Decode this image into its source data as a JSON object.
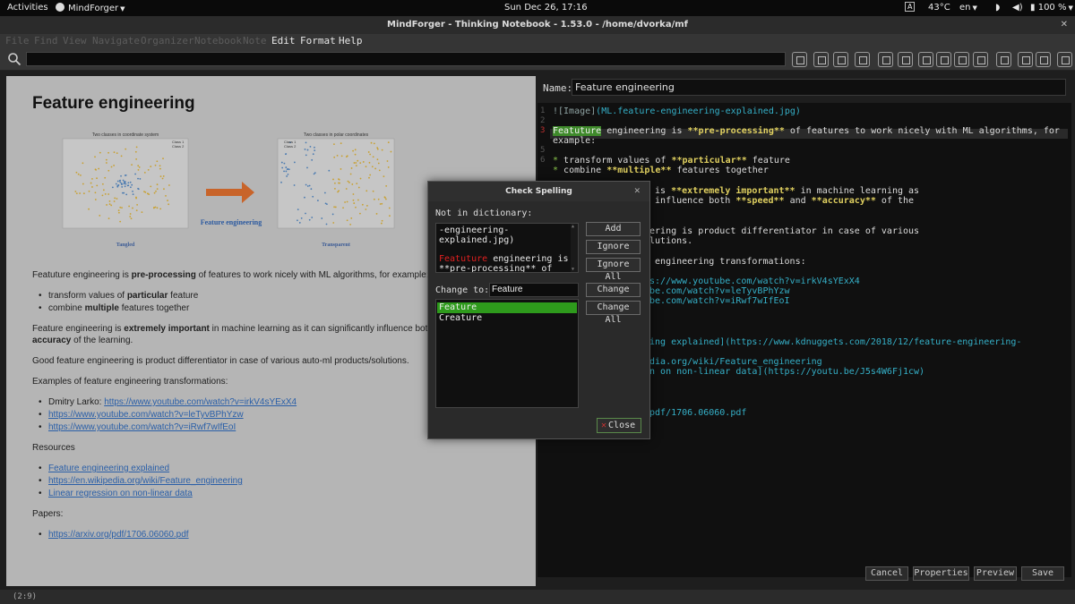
{
  "system_bar": {
    "activities": "Activities",
    "app_menu": "MindForger",
    "clock": "Sun Dec 26, 17:16",
    "keyboard": "A",
    "temperature": "43°C",
    "language": "en",
    "battery": "100 %"
  },
  "window": {
    "title": "MindForger - Thinking Notebook - 1.53.0 - /home/dvorka/mf"
  },
  "menubar": {
    "items": [
      "File",
      "Find",
      "View",
      "Navigate",
      "Organizer",
      "Notebook",
      "Note",
      "Edit",
      "Format",
      "Help"
    ]
  },
  "toolbar": {
    "icons": [
      "new-note-icon",
      "open-folder-icon",
      "notebooks-icon",
      "home-icon",
      "outline-icon",
      "grid-icon",
      "table-icon",
      "chart-icon",
      "tag-icon",
      "clock-icon",
      "lightbulb-icon",
      "filter-icon",
      "tools-icon",
      "adapt-icon"
    ]
  },
  "preview": {
    "title": "Feature engineering",
    "figure": {
      "left_title": "Two classes in coordinate system",
      "right_title": "Two classes in polar coordinates",
      "legend_1": "Class 1",
      "legend_2": "Class 2",
      "left_caption": "Tangled",
      "right_caption": "Transparent",
      "center_caption": "Feature engineering"
    },
    "p1_a": "Featuture engineering is ",
    "p1_b": "pre-processing",
    "p1_c": " of features to work nicely with ML algorithms, for example:",
    "b1_a": "transform values of ",
    "b1_b": "particular",
    "b1_c": " feature",
    "b2_a": "combine ",
    "b2_b": "multiple",
    "b2_c": " features together",
    "p2_a": "Feature engineering is ",
    "p2_b": "extremely important",
    "p2_c": " in machine learning as it can significantly influence both ",
    "p2_d": "accuracy",
    "p2_e": " of the learning.",
    "p3": "Good feature engineering is product differentiator in case of various auto-ml products/solutions.",
    "p4": "Examples of feature engineering transformations:",
    "ex1_label": "Dmitry Larko: ",
    "ex1_link": "https://www.youtube.com/watch?v=irkV4sYExX4",
    "ex2_link": "https://www.youtube.com/watch?v=leTyvBPhYzw",
    "ex3_link": "https://www.youtube.com/watch?v=iRwf7wIfEoI",
    "resources": "Resources",
    "r1": "Feature engineering explained",
    "r2": "https://en.wikipedia.org/wiki/Feature_engineering",
    "r3": "Linear regression on non-linear data",
    "papers": "Papers:",
    "paper1": "https://arxiv.org/pdf/1706.06060.pdf"
  },
  "editor": {
    "name_label": "Name:",
    "name_value": "Feature engineering",
    "lines": {
      "l1_a": "![Image]",
      "l1_b": "(ML.feature-engineering-explained.jpg)",
      "l3_sel": "Featuture",
      "l3_a": " engineering is ",
      "l3_b": "**pre-processing**",
      "l3_c": " of features to work nicely with ML algorithms, for",
      "l4": "example:",
      "l6_a": "* ",
      "l6_b": "transform values of ",
      "l6_c": "**particular**",
      "l6_d": " feature",
      "l7_a": "* ",
      "l7_b": "combine ",
      "l7_c": "**multiple**",
      "l7_d": " features together",
      "l9_a": "g is ",
      "l9_b": "**extremely important**",
      "l9_c": " in machine learning as",
      "l10_a": "y influence both ",
      "l10_b": "**speed**",
      "l10_c": " and ",
      "l10_d": "**accuracy**",
      "l10_e": " of the",
      "l12": "eering is product differentiator in case of various",
      "l13": "olutions.",
      "l15": "e engineering transformations:",
      "l17": "ps://www.youtube.com/watch?v=irkV4sYExX4",
      "l18": "ube.com/watch?v=leTyvBPhYzw",
      "l19": "ube.com/watch?v=iRwf7wIfEoI",
      "l23": "ring explained](https://www.kdnuggets.com/2018/12/feature-engineering-",
      "l25": "edia.org/wiki/Feature_engineering",
      "l26": "on on non-linear data](https://youtu.be/J5s4W6Fj1cw)",
      "l30": "/pdf/1706.06060.pdf"
    },
    "gutter": [
      "1",
      "2",
      "3",
      "4",
      "5",
      "6"
    ]
  },
  "bottom_buttons": {
    "cancel": "Cancel",
    "properties": "Properties",
    "preview": "Preview",
    "save": "Save"
  },
  "status": "(2:9)",
  "dialog": {
    "title": "Check Spelling",
    "not_in_dict_label": "Not in dictionary:",
    "context_line1": "-engineering-",
    "context_line2": "explained.jpg)",
    "context_bad": "Featuture",
    "context_line3_rest": " engineering is",
    "context_line4": "**pre-processing** of",
    "change_to_label": "Change to:",
    "change_to_value": "Feature",
    "suggestions": [
      "Feature",
      "Creature"
    ],
    "add": "Add",
    "ignore": "Ignore",
    "ignore_all": "Ignore All",
    "change": "Change",
    "change_all": "Change All",
    "close": "Close"
  },
  "colors": {
    "selection_green": "#2e9a1c",
    "misspelled_red": "#e02020",
    "link_blue": "#2a5fa8",
    "preview_bg": "#b5b5b5"
  }
}
